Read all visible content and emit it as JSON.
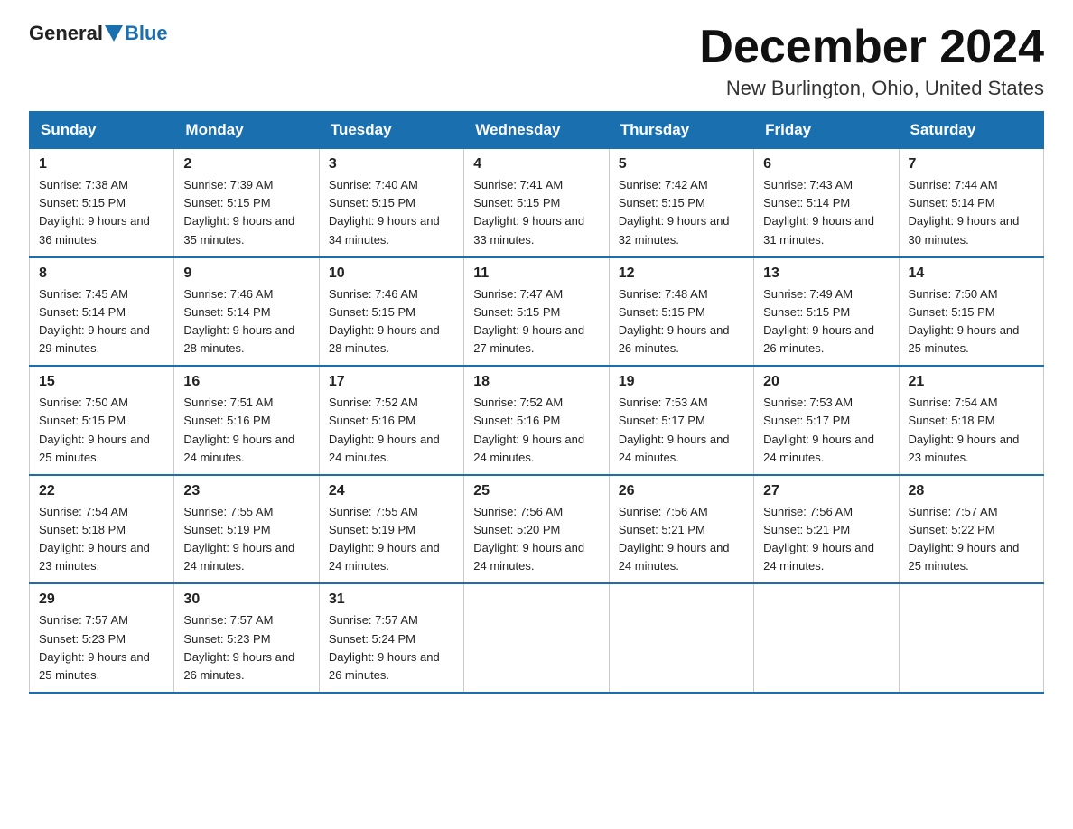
{
  "header": {
    "logo_general": "General",
    "logo_blue": "Blue",
    "month_title": "December 2024",
    "location": "New Burlington, Ohio, United States"
  },
  "days_of_week": [
    "Sunday",
    "Monday",
    "Tuesday",
    "Wednesday",
    "Thursday",
    "Friday",
    "Saturday"
  ],
  "weeks": [
    [
      {
        "day": "1",
        "sunrise": "7:38 AM",
        "sunset": "5:15 PM",
        "daylight": "9 hours and 36 minutes."
      },
      {
        "day": "2",
        "sunrise": "7:39 AM",
        "sunset": "5:15 PM",
        "daylight": "9 hours and 35 minutes."
      },
      {
        "day": "3",
        "sunrise": "7:40 AM",
        "sunset": "5:15 PM",
        "daylight": "9 hours and 34 minutes."
      },
      {
        "day": "4",
        "sunrise": "7:41 AM",
        "sunset": "5:15 PM",
        "daylight": "9 hours and 33 minutes."
      },
      {
        "day": "5",
        "sunrise": "7:42 AM",
        "sunset": "5:15 PM",
        "daylight": "9 hours and 32 minutes."
      },
      {
        "day": "6",
        "sunrise": "7:43 AM",
        "sunset": "5:14 PM",
        "daylight": "9 hours and 31 minutes."
      },
      {
        "day": "7",
        "sunrise": "7:44 AM",
        "sunset": "5:14 PM",
        "daylight": "9 hours and 30 minutes."
      }
    ],
    [
      {
        "day": "8",
        "sunrise": "7:45 AM",
        "sunset": "5:14 PM",
        "daylight": "9 hours and 29 minutes."
      },
      {
        "day": "9",
        "sunrise": "7:46 AM",
        "sunset": "5:14 PM",
        "daylight": "9 hours and 28 minutes."
      },
      {
        "day": "10",
        "sunrise": "7:46 AM",
        "sunset": "5:15 PM",
        "daylight": "9 hours and 28 minutes."
      },
      {
        "day": "11",
        "sunrise": "7:47 AM",
        "sunset": "5:15 PM",
        "daylight": "9 hours and 27 minutes."
      },
      {
        "day": "12",
        "sunrise": "7:48 AM",
        "sunset": "5:15 PM",
        "daylight": "9 hours and 26 minutes."
      },
      {
        "day": "13",
        "sunrise": "7:49 AM",
        "sunset": "5:15 PM",
        "daylight": "9 hours and 26 minutes."
      },
      {
        "day": "14",
        "sunrise": "7:50 AM",
        "sunset": "5:15 PM",
        "daylight": "9 hours and 25 minutes."
      }
    ],
    [
      {
        "day": "15",
        "sunrise": "7:50 AM",
        "sunset": "5:15 PM",
        "daylight": "9 hours and 25 minutes."
      },
      {
        "day": "16",
        "sunrise": "7:51 AM",
        "sunset": "5:16 PM",
        "daylight": "9 hours and 24 minutes."
      },
      {
        "day": "17",
        "sunrise": "7:52 AM",
        "sunset": "5:16 PM",
        "daylight": "9 hours and 24 minutes."
      },
      {
        "day": "18",
        "sunrise": "7:52 AM",
        "sunset": "5:16 PM",
        "daylight": "9 hours and 24 minutes."
      },
      {
        "day": "19",
        "sunrise": "7:53 AM",
        "sunset": "5:17 PM",
        "daylight": "9 hours and 24 minutes."
      },
      {
        "day": "20",
        "sunrise": "7:53 AM",
        "sunset": "5:17 PM",
        "daylight": "9 hours and 24 minutes."
      },
      {
        "day": "21",
        "sunrise": "7:54 AM",
        "sunset": "5:18 PM",
        "daylight": "9 hours and 23 minutes."
      }
    ],
    [
      {
        "day": "22",
        "sunrise": "7:54 AM",
        "sunset": "5:18 PM",
        "daylight": "9 hours and 23 minutes."
      },
      {
        "day": "23",
        "sunrise": "7:55 AM",
        "sunset": "5:19 PM",
        "daylight": "9 hours and 24 minutes."
      },
      {
        "day": "24",
        "sunrise": "7:55 AM",
        "sunset": "5:19 PM",
        "daylight": "9 hours and 24 minutes."
      },
      {
        "day": "25",
        "sunrise": "7:56 AM",
        "sunset": "5:20 PM",
        "daylight": "9 hours and 24 minutes."
      },
      {
        "day": "26",
        "sunrise": "7:56 AM",
        "sunset": "5:21 PM",
        "daylight": "9 hours and 24 minutes."
      },
      {
        "day": "27",
        "sunrise": "7:56 AM",
        "sunset": "5:21 PM",
        "daylight": "9 hours and 24 minutes."
      },
      {
        "day": "28",
        "sunrise": "7:57 AM",
        "sunset": "5:22 PM",
        "daylight": "9 hours and 25 minutes."
      }
    ],
    [
      {
        "day": "29",
        "sunrise": "7:57 AM",
        "sunset": "5:23 PM",
        "daylight": "9 hours and 25 minutes."
      },
      {
        "day": "30",
        "sunrise": "7:57 AM",
        "sunset": "5:23 PM",
        "daylight": "9 hours and 26 minutes."
      },
      {
        "day": "31",
        "sunrise": "7:57 AM",
        "sunset": "5:24 PM",
        "daylight": "9 hours and 26 minutes."
      },
      null,
      null,
      null,
      null
    ]
  ]
}
